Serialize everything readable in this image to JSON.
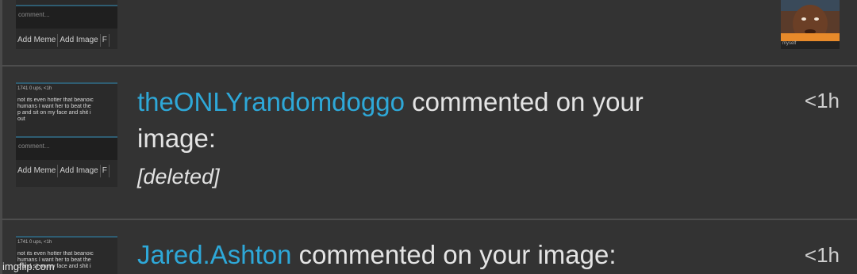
{
  "items": [
    {
      "thumb": {
        "comment_placeholder": "comment...",
        "buttons": [
          "Add Meme",
          "Add Image",
          "F"
        ]
      },
      "avatar_caption": "myself"
    },
    {
      "thumb": {
        "meta": "1741   0 ups, <1h",
        "text": "not its even hotter that beanoic\nhumans I want her to beat the\np and sit on my face and shit i\nout",
        "comment_placeholder": "comment...",
        "buttons": [
          "Add Meme",
          "Add Image",
          "F"
        ]
      },
      "username": "theONLYrandomdoggo",
      "action_line1": " commented on your",
      "action_line2": "image:",
      "body": "[deleted]",
      "time": "<1h"
    },
    {
      "thumb": {
        "meta": "1741   0 ups, <1h",
        "text": "not its even hotter that beanoic\nhumans I want her to beat the\np and sit on my face and shit i"
      },
      "username": "Jared.Ashton",
      "action_line1": " commented on your image:",
      "time": "<1h"
    }
  ],
  "watermark": "imgflip.com",
  "colors": {
    "background": "#333333",
    "username": "#2ea8d8",
    "divider": "#4d4d4d"
  }
}
